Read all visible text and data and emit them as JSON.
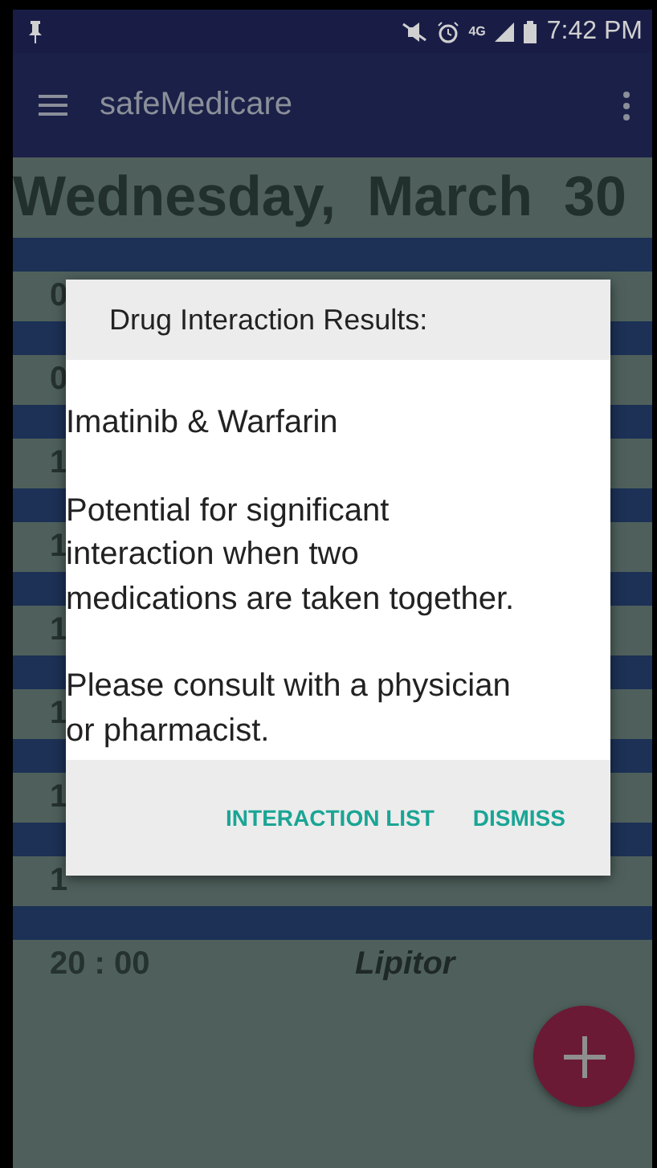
{
  "status_bar": {
    "network_type": "4G",
    "time": "7:42 PM"
  },
  "app_bar": {
    "title": "safeMedicare"
  },
  "date_heading": "Wednesday,  March  30",
  "schedule": [
    {
      "time": "0"
    },
    {
      "time": "0"
    },
    {
      "time": "1"
    },
    {
      "time": "1"
    },
    {
      "time": "1"
    },
    {
      "time": "1"
    },
    {
      "time": "1"
    },
    {
      "time": "1"
    },
    {
      "time": "20 : 00",
      "medication": "Lipitor"
    }
  ],
  "dialog": {
    "title": "Drug Interaction Results:",
    "paragraphs": [
      "Imatinib & Warfarin",
      "Potential for significant interaction when two medications are taken together.",
      "Please consult with a physician or pharmacist."
    ],
    "buttons": [
      "INTERACTION LIST",
      "DISMISS"
    ]
  }
}
